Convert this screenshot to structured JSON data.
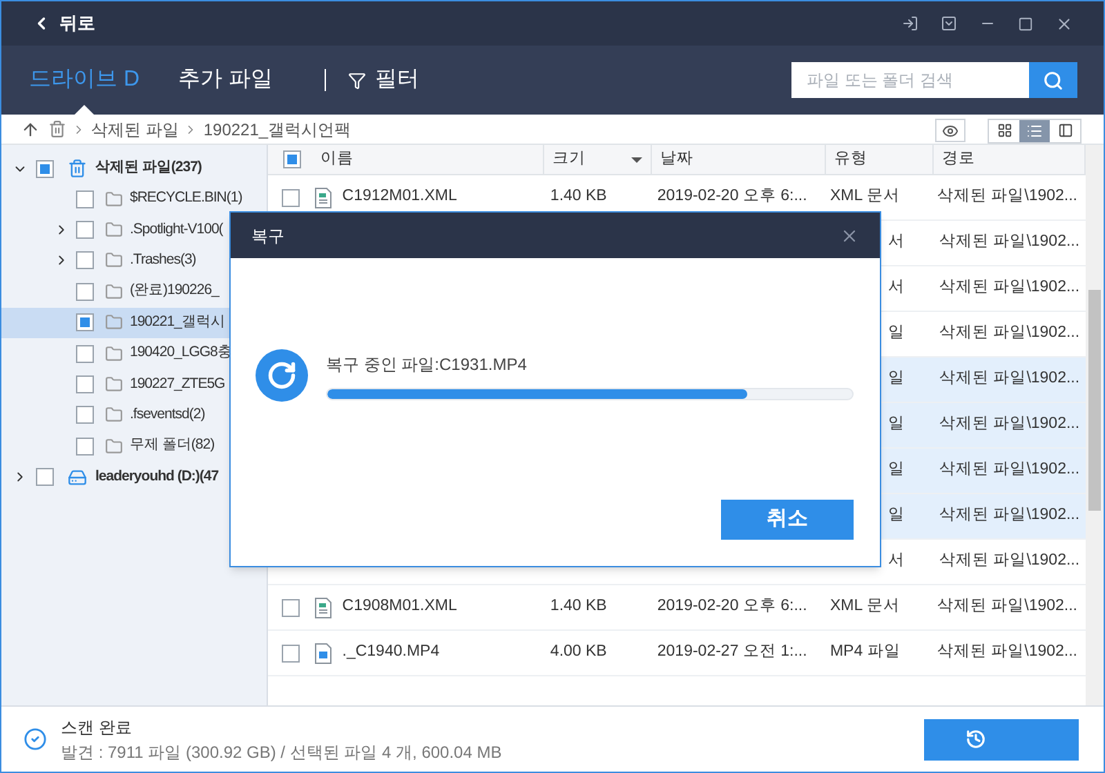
{
  "titlebar": {
    "back": "뒤로"
  },
  "nav": {
    "tabs": [
      {
        "label": "드라이브 D",
        "selected": true
      },
      {
        "label": "추가 파일",
        "selected": false
      }
    ],
    "filter": "필터",
    "search": {
      "placeholder": "파일 또는 폴더 검색"
    }
  },
  "breadcrumb": [
    "삭제된 파일",
    "190221_갤럭시언팩"
  ],
  "view_modes": [
    {
      "kind": "grid",
      "selected": false
    },
    {
      "kind": "list",
      "selected": true
    },
    {
      "kind": "preview",
      "selected": false
    }
  ],
  "tree": [
    {
      "label": "삭제된 파일(237)",
      "kind": "trash",
      "partial": true,
      "expanded": true,
      "selected": false,
      "children": [
        {
          "label": "$RECYCLE.BIN(1)",
          "partial": false,
          "expandable": false,
          "selected": false
        },
        {
          "label": ".Spotlight-V100(",
          "partial": false,
          "expandable": true,
          "selected": false
        },
        {
          "label": ".Trashes(3)",
          "partial": false,
          "expandable": true,
          "selected": false
        },
        {
          "label": "(완료)190226_",
          "partial": false,
          "expandable": false,
          "selected": false
        },
        {
          "label": "190221_갤럭시",
          "partial": true,
          "expandable": false,
          "selected": true
        },
        {
          "label": "190420_LGG8충",
          "partial": false,
          "expandable": false,
          "selected": false
        },
        {
          "label": "190227_ZTE5G",
          "partial": false,
          "expandable": false,
          "selected": false
        },
        {
          "label": ".fseventsd(2)",
          "partial": false,
          "expandable": false,
          "selected": false
        },
        {
          "label": "무제 폴더(82)",
          "partial": false,
          "expandable": false,
          "selected": false
        }
      ]
    },
    {
      "label": "leaderyouhd (D:)(47",
      "kind": "drive",
      "partial": false,
      "expanded": false,
      "selected": false
    }
  ],
  "table": {
    "header_partial": true,
    "columns": [
      {
        "label": "이름",
        "sorted": false
      },
      {
        "label": "크기",
        "sorted": true
      },
      {
        "label": "날짜",
        "sorted": false
      },
      {
        "label": "유형",
        "sorted": false
      },
      {
        "label": "경로",
        "sorted": false
      }
    ],
    "rows": [
      {
        "kind": "xml",
        "partial": false,
        "name": "C1912M01.XML",
        "size": "1.40 KB",
        "date": "2019-02-20 오후 6:...",
        "type": "XML 문서",
        "path": "삭제된 파일\\1902...",
        "selected": false
      },
      {
        "kind": "covered",
        "type": "서",
        "path": "삭제된 파일\\1902...",
        "selected": false
      },
      {
        "kind": "covered",
        "type": "서",
        "path": "삭제된 파일\\1902...",
        "selected": false
      },
      {
        "kind": "covered",
        "type": "일",
        "path": "삭제된 파일\\1902...",
        "selected": false
      },
      {
        "kind": "covered",
        "type": "일",
        "path": "삭제된 파일\\1902...",
        "selected": true
      },
      {
        "kind": "covered",
        "type": "일",
        "path": "삭제된 파일\\1902...",
        "selected": true
      },
      {
        "kind": "covered",
        "type": "일",
        "path": "삭제된 파일\\1902...",
        "selected": true
      },
      {
        "kind": "covered",
        "type": "일",
        "path": "삭제된 파일\\1902...",
        "selected": true
      },
      {
        "kind": "covered",
        "type": "서",
        "path": "삭제된 파일\\1902...",
        "selected": false
      },
      {
        "kind": "xml",
        "partial": false,
        "name": "C1908M01.XML",
        "size": "1.40 KB",
        "date": "2019-02-20 오후 6:...",
        "type": "XML 문서",
        "path": "삭제된 파일\\1902...",
        "selected": false
      },
      {
        "kind": "mp4",
        "partial": false,
        "name": "._C1940.MP4",
        "size": "4.00 KB",
        "date": "2019-02-27 오전 1:...",
        "type": "MP4 파일",
        "path": "삭제된 파일\\1902...",
        "selected": false
      }
    ]
  },
  "dialog": {
    "title": "복구",
    "message": "복구 중인 파일:C1931.MP4",
    "level": 0.8,
    "cancel": "취소"
  },
  "status": {
    "title": "스캔 완료",
    "detail": "발견 : 7911 파일 (300.92 GB) / 선택된 파일 4 개, 600.04 MB"
  }
}
